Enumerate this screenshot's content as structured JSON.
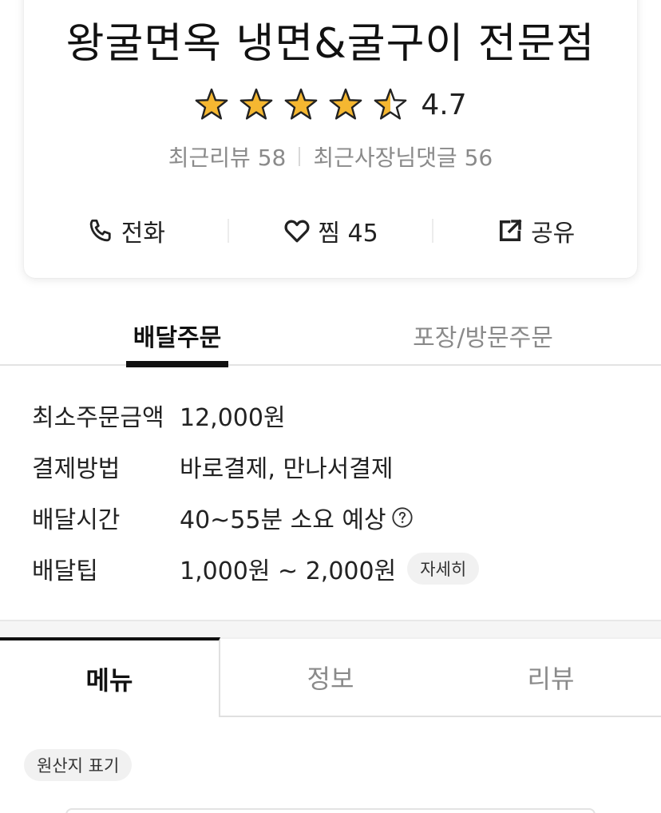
{
  "store": {
    "name": "왕굴면옥 냉면&굴구이 전문점",
    "rating": 4.7,
    "rating_text": "4.7",
    "star_color": "#F5B731",
    "stars_max": 5
  },
  "counts": {
    "recent_reviews": "최근리뷰 58",
    "recent_owner_replies": "최근사장님댓글 56"
  },
  "actions": {
    "call_label": "전화",
    "like_label": "찜 45",
    "share_label": "공유"
  },
  "order_tabs": {
    "delivery": "배달주문",
    "pickup": "포장/방문주문"
  },
  "info": [
    {
      "label": "최소주문금액",
      "value": "12,000원"
    },
    {
      "label": "결제방법",
      "value": "바로결제, 만나서결제"
    },
    {
      "label": "배달시간",
      "value": "40~55분 소요 예상"
    },
    {
      "label": "배달팁",
      "value": "1,000원 ~ 2,000원"
    }
  ],
  "detail_chip": "자세히",
  "main_tabs": [
    "메뉴",
    "정보",
    "리뷰"
  ],
  "origin_chip": "원산지 표기"
}
